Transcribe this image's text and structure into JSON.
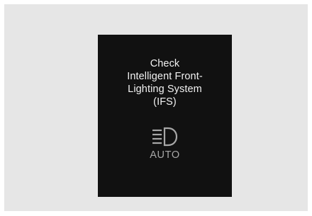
{
  "warning": {
    "message_lines": [
      "Check",
      "Intelligent Front-",
      "Lighting System",
      "(IFS)"
    ],
    "indicator_icon": "headlamp-icon",
    "indicator_label": "AUTO"
  },
  "colors": {
    "screen_background": "#111111",
    "page_background": "#e6e6e6",
    "message_text": "#f2f2f2",
    "indicator": "#a7a7a7"
  }
}
